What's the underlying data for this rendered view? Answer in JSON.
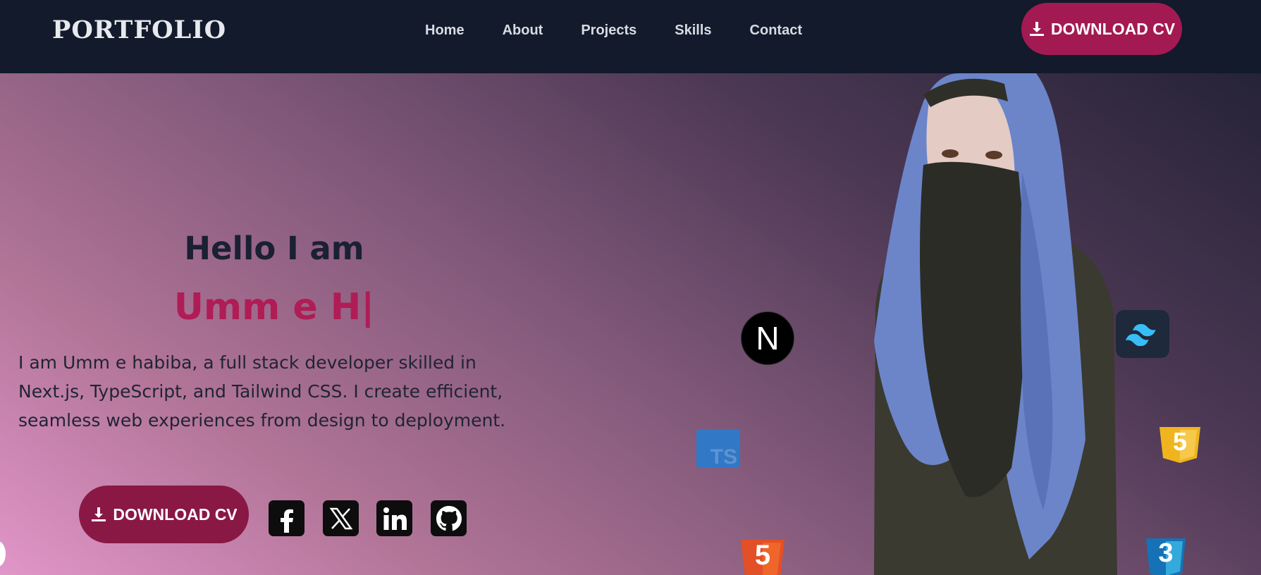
{
  "header": {
    "logo": "PORTFOLIO",
    "nav": [
      "Home",
      "About",
      "Projects",
      "Skills",
      "Contact"
    ],
    "cv_button_label": "DOWNLOAD CV"
  },
  "hero": {
    "greeting": "Hello I am",
    "name": "Umm e H|",
    "bio": "I am Umm e habiba, a full stack developer skilled in Next.js, TypeScript, and Tailwind CSS. I create efficient, seamless web experiences from design to deployment.",
    "cv_button_label": "DOWNLOAD CV",
    "socials": [
      "facebook-icon",
      "x-twitter-icon",
      "linkedin-icon",
      "github-icon"
    ],
    "tech_icons": {
      "nextjs": "N",
      "typescript": "TS",
      "html5": "5",
      "css3": "3",
      "javascript": "5"
    }
  },
  "colors": {
    "navbar": "#121a2b",
    "accent": "#a31a52",
    "accent_dark": "#891845",
    "name": "#b01c55",
    "text_dark": "#1b2033"
  }
}
